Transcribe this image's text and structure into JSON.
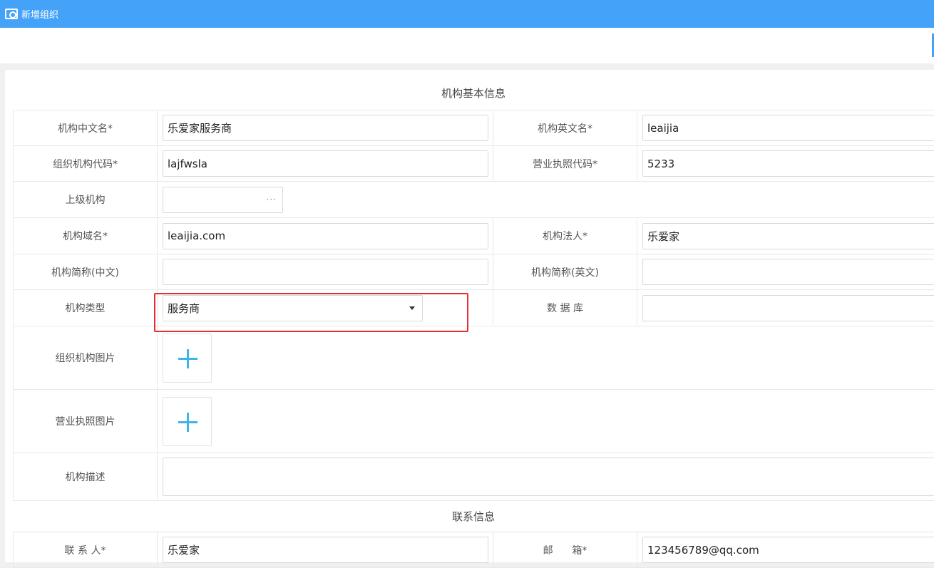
{
  "window": {
    "title": "新增组织"
  },
  "sections": {
    "basic": "机构基本信息",
    "contact": "联系信息"
  },
  "fields": {
    "name_cn": {
      "label": "机构中文名*",
      "value": "乐爱家服务商"
    },
    "name_en": {
      "label": "机构英文名*",
      "value": "leaijia"
    },
    "org_code": {
      "label": "组织机构代码*",
      "value": "lajfwsla"
    },
    "license_code": {
      "label": "营业执照代码*",
      "value": "5233"
    },
    "parent": {
      "label": "上级机构",
      "value": "",
      "picker": "···"
    },
    "domain": {
      "label": "机构域名*",
      "value": "leaijia.com"
    },
    "legal": {
      "label": "机构法人*",
      "value": "乐爱家"
    },
    "short_cn": {
      "label": "机构简称(中文)",
      "value": ""
    },
    "short_en": {
      "label": "机构简称(英文)",
      "value": ""
    },
    "type": {
      "label": "机构类型",
      "value": "服务商"
    },
    "database": {
      "label": "数 据 库",
      "value": ""
    },
    "org_image": {
      "label": "组织机构图片"
    },
    "license_image": {
      "label": "营业执照图片"
    },
    "description": {
      "label": "机构描述",
      "value": ""
    },
    "contact": {
      "label": "联 系 人*",
      "value": "乐爱家"
    },
    "email": {
      "label": "邮      箱*",
      "value": "123456789@qq.com"
    }
  }
}
